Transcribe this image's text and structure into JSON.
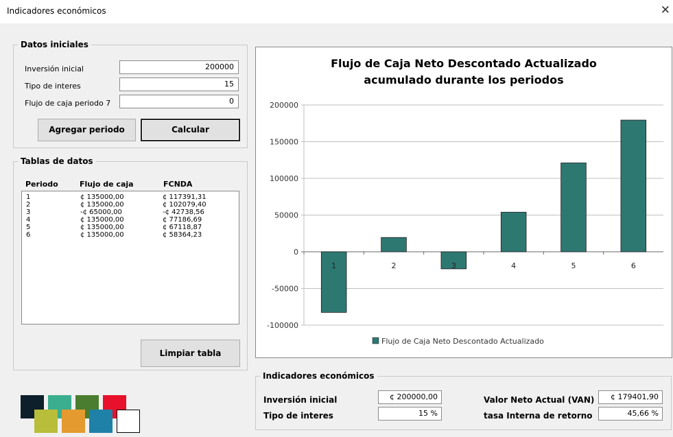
{
  "window": {
    "title": "Indicadores económicos",
    "close_glyph": "✕"
  },
  "datos_iniciales": {
    "legend": "Datos iniciales",
    "inversion_label": "Inversión inicial",
    "inversion_value": "200000",
    "tipo_label": "Tipo de interes",
    "tipo_value": "15",
    "flujo_label": "Flujo de caja periodo 7",
    "flujo_value": "0",
    "agregar_button": "Agregar periodo",
    "calcular_button": "Calcular"
  },
  "tablas": {
    "legend": "Tablas de datos",
    "headers": [
      "Periodo",
      "Flujo de caja",
      "FCNDA"
    ],
    "rows": [
      [
        "1",
        "¢ 135000,00",
        "¢ 117391,31"
      ],
      [
        "2",
        "¢ 135000,00",
        "¢ 102079,40"
      ],
      [
        "3",
        "-¢ 65000,00",
        "-¢ 42738,56"
      ],
      [
        "4",
        "¢ 135000,00",
        "¢ 77186,69"
      ],
      [
        "5",
        "¢ 135000,00",
        "¢ 67118,87"
      ],
      [
        "6",
        "¢ 135000,00",
        "¢ 58364,23"
      ]
    ],
    "limpiar_button": "Limpiar tabla"
  },
  "chart_data": {
    "type": "bar",
    "title_line1": "Flujo de Caja Neto Descontado Actualizado",
    "title_line2": "acumulado durante los periodos",
    "categories": [
      "1",
      "2",
      "3",
      "4",
      "5",
      "6"
    ],
    "series": [
      {
        "name": "Flujo de Caja Neto Descontado Actualizado",
        "values": [
          -82609,
          19470,
          -23268,
          53918,
          121037,
          179402
        ]
      }
    ],
    "ylim": [
      -100000,
      200000
    ],
    "yticks": [
      200000,
      150000,
      100000,
      50000,
      0,
      -50000,
      -100000
    ],
    "ytick_labels": [
      "200000",
      "150000",
      "100000",
      "50000",
      "0",
      "-50000",
      "-100000"
    ],
    "grid": true,
    "legend_position": "bottom",
    "bar_color": "#2e7872"
  },
  "indicadores": {
    "legend": "Indicadores económicos",
    "inversion_label": "Inversión inicial",
    "inversion_value": "¢ 200000,00",
    "tipo_label": "Tipo de interes",
    "tipo_value": "15 %",
    "van_label": "Valor Neto Actual (VAN)",
    "van_value": "¢ 179401,90",
    "tir_label": "tasa Interna de retorno",
    "tir_value": "45,66 %"
  },
  "palette_colors": [
    "#0d1f2a",
    "#3aae8e",
    "#4a7d2f",
    "#e8102a",
    "#b8bd3a",
    "#e49a2f",
    "#1f80a8",
    "#ffffff"
  ]
}
